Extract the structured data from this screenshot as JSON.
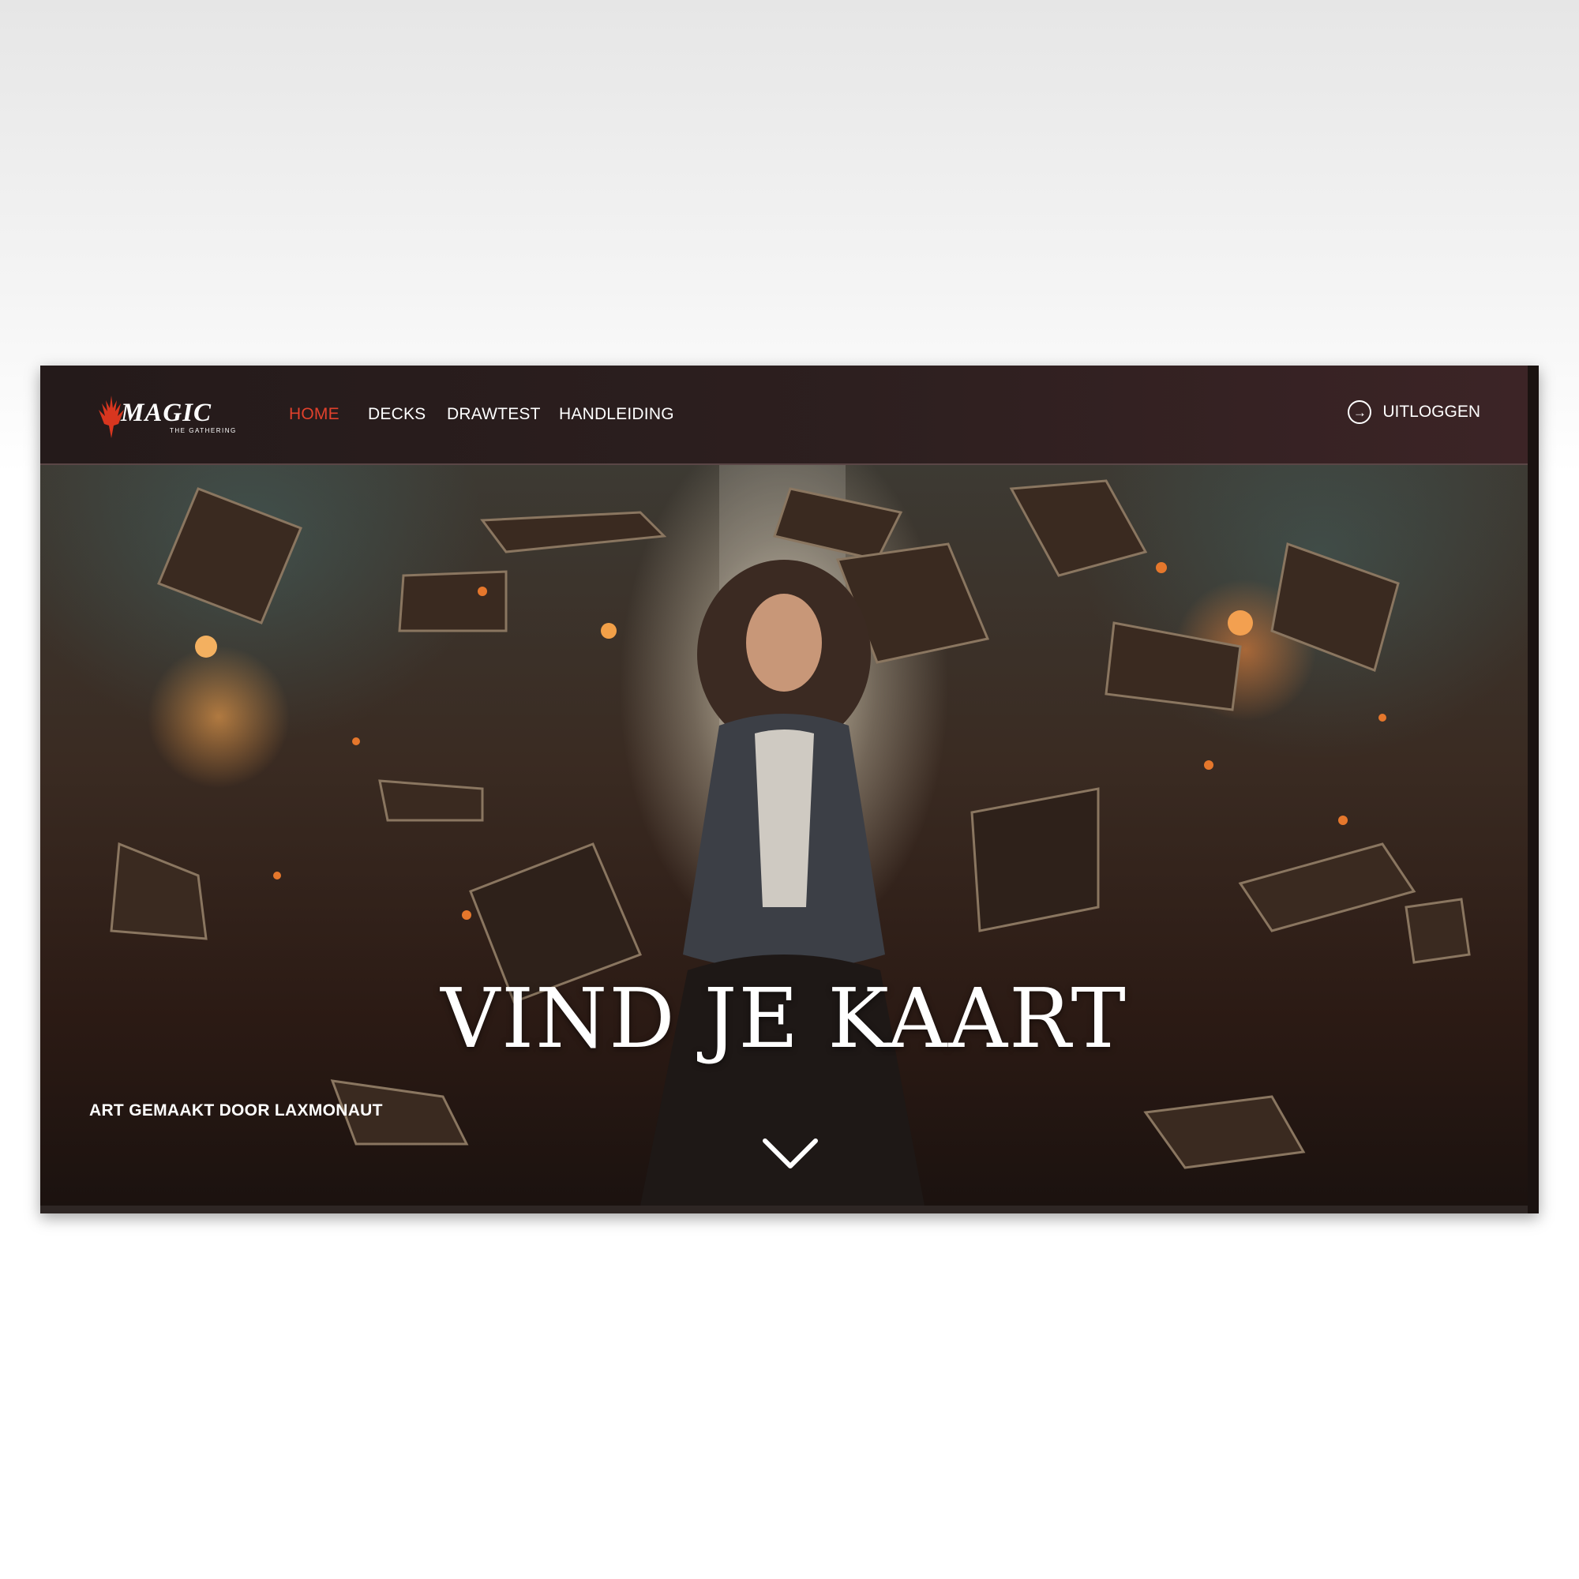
{
  "brand": {
    "name": "MAGIC",
    "tagline": "THE GATHERING",
    "accent": "#e1412c"
  },
  "nav": {
    "items": [
      {
        "label": "HOME",
        "active": true
      },
      {
        "label": "DECKS",
        "active": false
      },
      {
        "label": "DRAWTEST",
        "active": false
      },
      {
        "label": "HANDLEIDING",
        "active": false
      }
    ]
  },
  "logout": {
    "label": "UITLOGGEN",
    "icon": "arrow-right-circle-icon"
  },
  "hero": {
    "title": "VIND JE KAART",
    "credit": "ART GEMAAKT DOOR LAXMONAUT",
    "scroll_icon": "chevron-down-icon"
  }
}
